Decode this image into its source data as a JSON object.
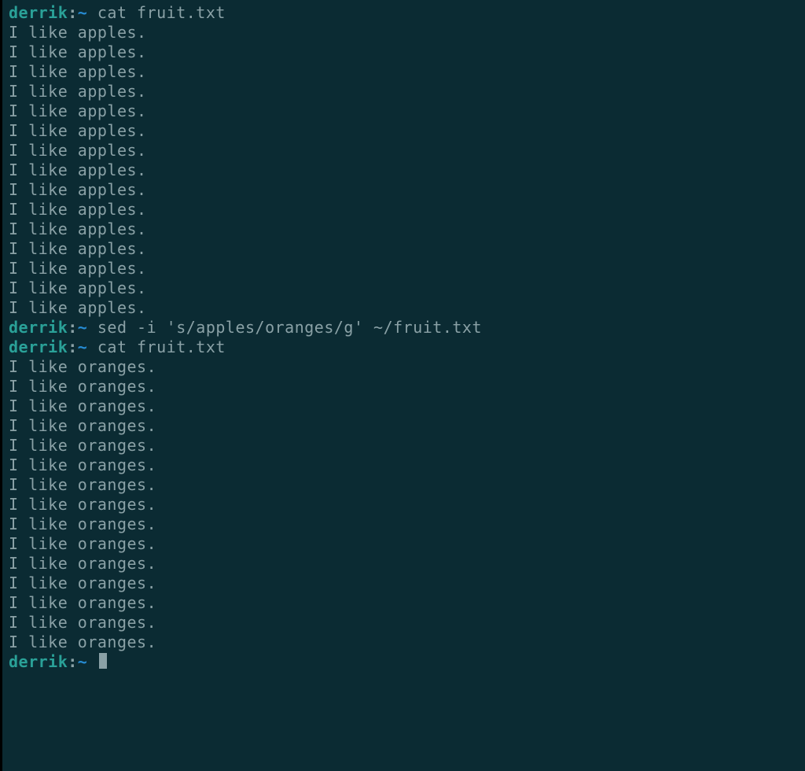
{
  "prompt": {
    "user": "derrik",
    "sep": ":",
    "path": "~",
    "symbol": " "
  },
  "blocks": [
    {
      "type": "command",
      "text": "cat fruit.txt"
    },
    {
      "type": "output_repeat",
      "text": "I like apples.",
      "count": 15
    },
    {
      "type": "command",
      "text": "sed -i 's/apples/oranges/g' ~/fruit.txt"
    },
    {
      "type": "command",
      "text": "cat fruit.txt"
    },
    {
      "type": "output_repeat",
      "text": "I like oranges.",
      "count": 15
    },
    {
      "type": "prompt_cursor"
    }
  ]
}
